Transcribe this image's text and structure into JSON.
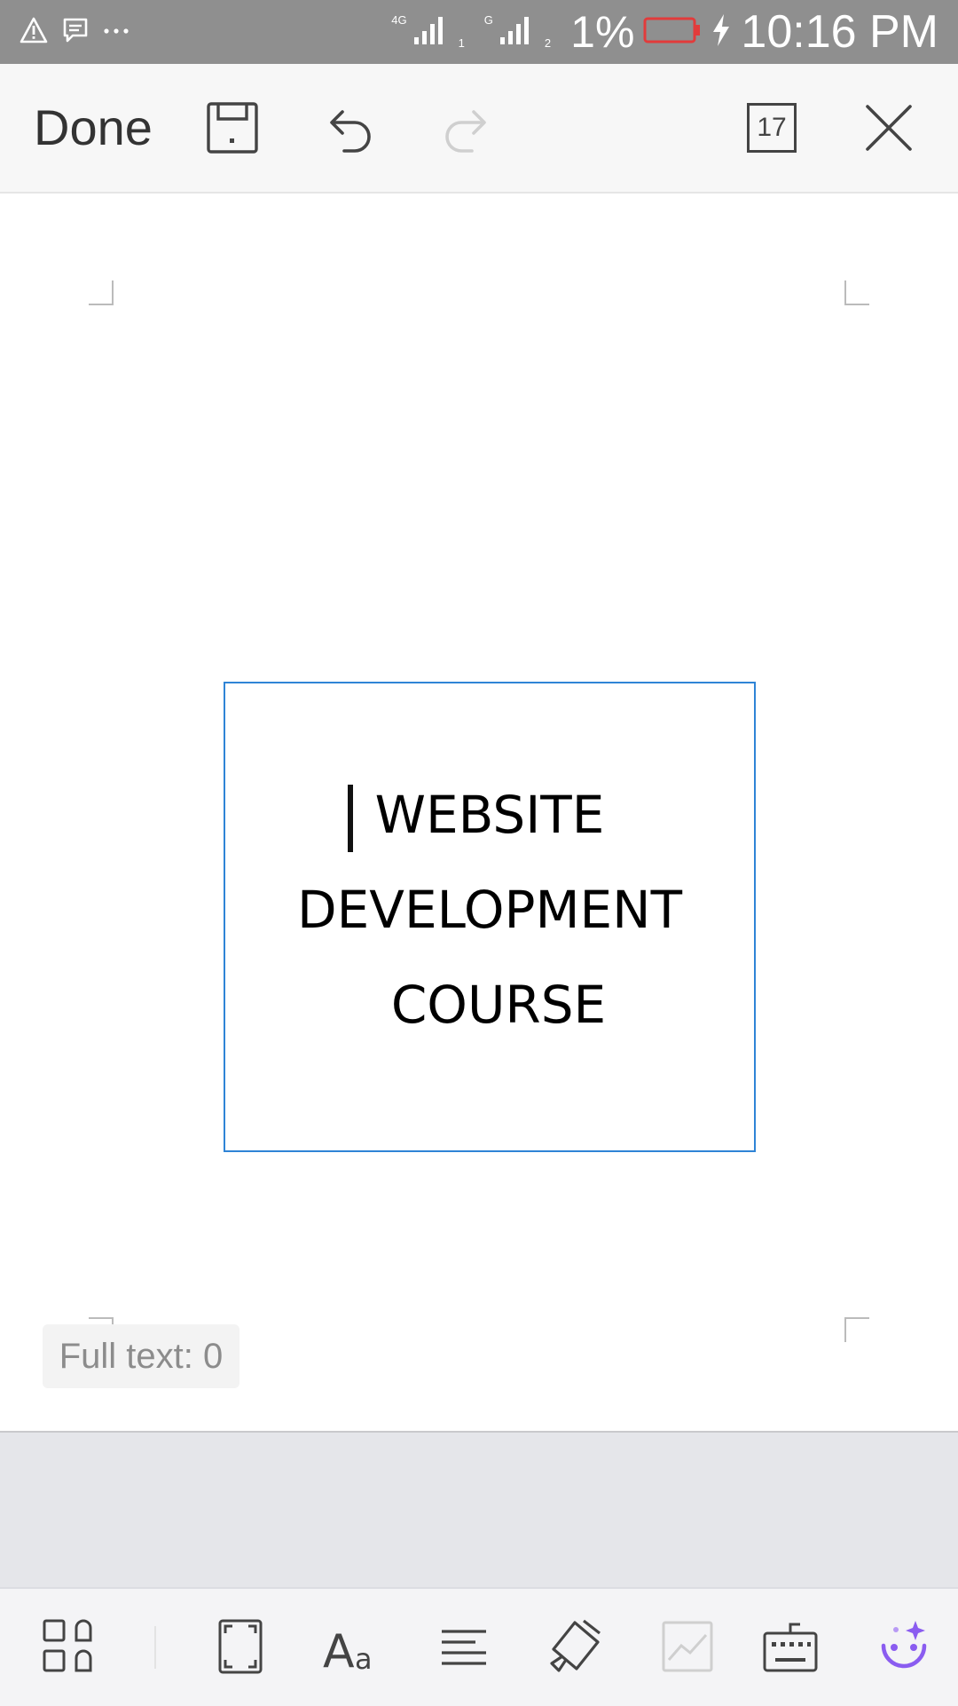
{
  "status_bar": {
    "network_1": "4G",
    "network_1_sub": "1",
    "network_2": "G",
    "network_2_sub": "2",
    "battery_percent": "1%",
    "time": "10:16 PM",
    "icons": [
      "warning-icon",
      "message-icon",
      "more-icon",
      "signal-icon",
      "battery-icon",
      "charging-icon"
    ]
  },
  "toolbar": {
    "done_label": "Done",
    "page_count": "17",
    "icons": [
      "save-icon",
      "undo-icon",
      "redo-icon",
      "page-count-icon",
      "close-icon"
    ]
  },
  "document": {
    "textbox_lines": [
      "WEBSITE",
      "DEVELOPMENT",
      "COURSE"
    ],
    "full_text_label": "Full text: 0"
  },
  "bottom_toolbar": {
    "icons": [
      "apps-icon",
      "frame-icon",
      "font-icon",
      "align-icon",
      "paint-icon",
      "chart-icon",
      "keyboard-icon",
      "assistant-icon"
    ]
  },
  "colors": {
    "status_bar": "#8f8f8f",
    "selection_border": "#2f84d6",
    "battery_low": "#e23b3b",
    "assistant": "#8a5cf0"
  }
}
